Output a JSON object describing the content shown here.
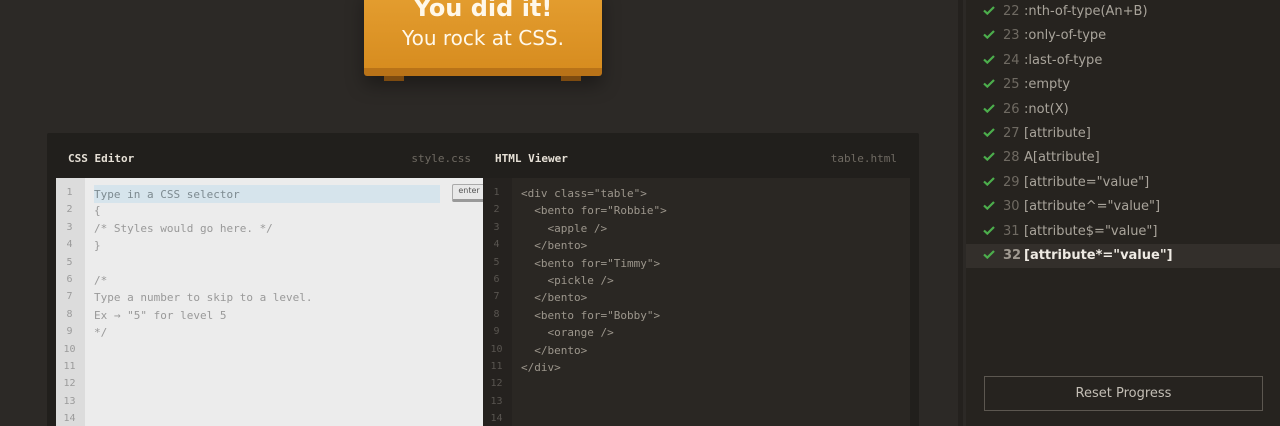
{
  "banner": {
    "line1": "You did it!",
    "line2": "You rock at CSS."
  },
  "css_editor": {
    "title": "CSS Editor",
    "file": "style.css",
    "input_placeholder": "Type in a CSS selector",
    "input_value": "",
    "enter_label": "enter",
    "line_numbers": [
      "1",
      "2",
      "3",
      "4",
      "5",
      "6",
      "7",
      "8",
      "9",
      "10",
      "11",
      "12",
      "13",
      "14"
    ],
    "lines": [
      "",
      "{",
      "/* Styles would go here. */",
      "}",
      "",
      "/*",
      "Type a number to skip to a level.",
      "Ex → \"5\" for level 5",
      "*/",
      "",
      "",
      "",
      "",
      ""
    ]
  },
  "html_viewer": {
    "title": "HTML Viewer",
    "file": "table.html",
    "line_numbers": [
      "1",
      "2",
      "3",
      "4",
      "5",
      "6",
      "7",
      "8",
      "9",
      "10",
      "11",
      "12",
      "13",
      "14"
    ],
    "lines": [
      "<div class=\"table\">",
      "  <bento for=\"Robbie\">",
      "    <apple />",
      "  </bento>",
      "  <bento for=\"Timmy\">",
      "    <pickle />",
      "  </bento>",
      "  <bento for=\"Bobby\">",
      "    <orange />",
      "  </bento>",
      "</div>",
      "",
      "",
      ""
    ]
  },
  "levels": {
    "items": [
      {
        "num": "22",
        "name": ":nth-of-type(An+B)",
        "done": true,
        "active": false
      },
      {
        "num": "23",
        "name": ":only-of-type",
        "done": true,
        "active": false
      },
      {
        "num": "24",
        "name": ":last-of-type",
        "done": true,
        "active": false
      },
      {
        "num": "25",
        "name": ":empty",
        "done": true,
        "active": false
      },
      {
        "num": "26",
        "name": ":not(X)",
        "done": true,
        "active": false
      },
      {
        "num": "27",
        "name": "[attribute]",
        "done": true,
        "active": false
      },
      {
        "num": "28",
        "name": "A[attribute]",
        "done": true,
        "active": false
      },
      {
        "num": "29",
        "name": "[attribute=\"value\"]",
        "done": true,
        "active": false
      },
      {
        "num": "30",
        "name": "[attribute^=\"value\"]",
        "done": true,
        "active": false
      },
      {
        "num": "31",
        "name": "[attribute$=\"value\"]",
        "done": true,
        "active": false
      },
      {
        "num": "32",
        "name": "[attribute*=\"value\"]",
        "done": true,
        "active": true
      }
    ],
    "check_icon": "check-icon",
    "check_color": "#4cae4c"
  },
  "reset_label": "Reset Progress"
}
